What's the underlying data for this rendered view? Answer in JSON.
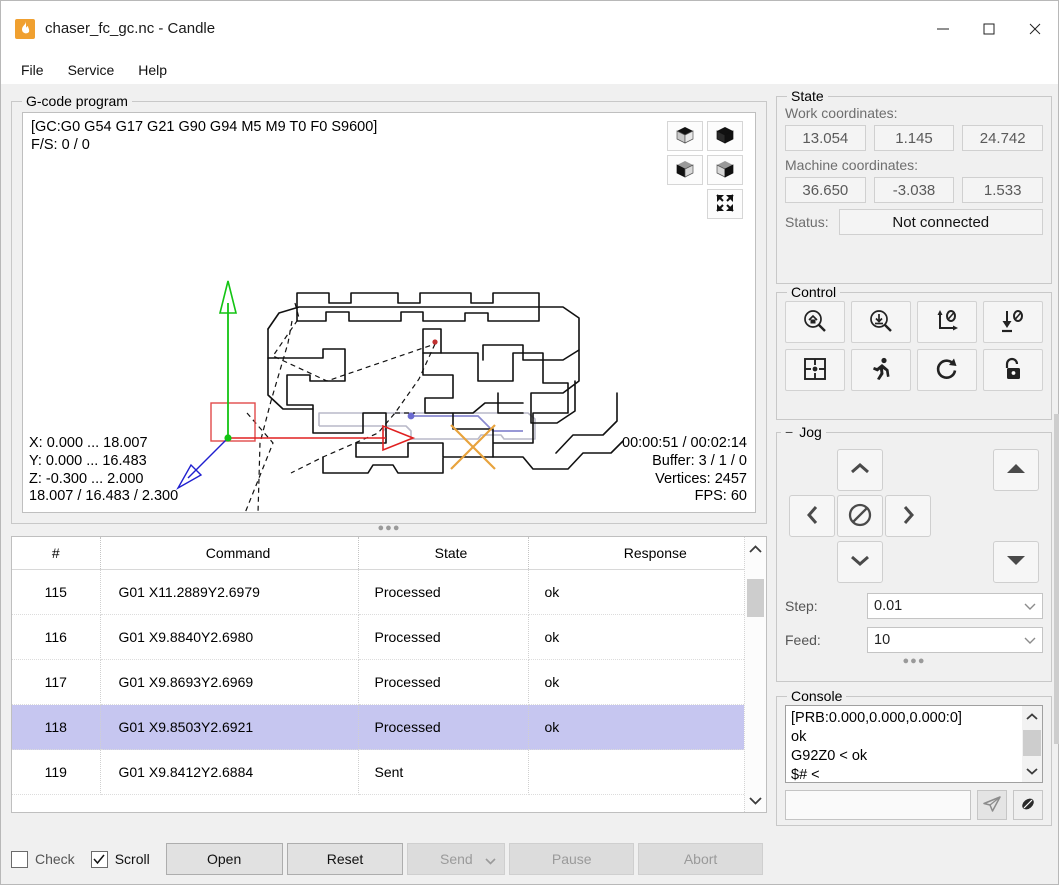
{
  "window": {
    "title": "chaser_fc_gc.nc - Candle",
    "app_icon": "flame-icon",
    "minimize": "—",
    "maximize": "□",
    "close": "✕"
  },
  "menubar": {
    "items": [
      "File",
      "Service",
      "Help"
    ]
  },
  "gcode_program": {
    "title": "G-code program",
    "viewer": {
      "overlay_top": "[GC:G0 G54 G17 G21 G90 G94 M5 M9 T0 F0 S9600]\nF/S: 0 / 0",
      "overlay_bottom_left": "X: 0.000 ... 18.007\nY: 0.000 ... 16.483\nZ: -0.300 ... 2.000\n18.007 / 16.483 / 2.300",
      "overlay_bottom_right": "00:00:51 / 00:02:14\nBuffer: 3 / 1 / 0\nVertices: 2457\nFPS: 60",
      "time_elapsed": "00:00:51",
      "time_total": "00:02:14",
      "buffer": "3 / 1 / 0",
      "vertices": "2457",
      "fps": "60",
      "toolbar_buttons": [
        {
          "name": "isometric-view-icon",
          "label": "Isometric view"
        },
        {
          "name": "top-view-icon",
          "label": "Top view"
        },
        {
          "name": "front-view-icon",
          "label": "Front view"
        },
        {
          "name": "left-view-icon",
          "label": "Left view"
        },
        {
          "name": "fit-to-screen-icon",
          "label": "Fit"
        }
      ],
      "colors": {
        "x_axis": "#e02020",
        "y_axis": "#13c413",
        "z_axis": "#2020d0",
        "toolpath": "#1a1a1a",
        "rapid": "#1a1a1a",
        "done": "#b9b9c8",
        "tool": "#e8a33d",
        "bounds": "#e24a4a"
      }
    }
  },
  "table": {
    "columns": [
      "#",
      "Command",
      "State",
      "Response"
    ],
    "rows": [
      {
        "num": "115",
        "command": "G01 X11.2889Y2.6979",
        "state": "Processed",
        "response": "ok",
        "selected": false
      },
      {
        "num": "116",
        "command": "G01 X9.8840Y2.6980",
        "state": "Processed",
        "response": "ok",
        "selected": false
      },
      {
        "num": "117",
        "command": "G01 X9.8693Y2.6969",
        "state": "Processed",
        "response": "ok",
        "selected": false
      },
      {
        "num": "118",
        "command": "G01 X9.8503Y2.6921",
        "state": "Processed",
        "response": "ok",
        "selected": true
      },
      {
        "num": "119",
        "command": "G01 X9.8412Y2.6884",
        "state": "Sent",
        "response": "",
        "selected": false
      }
    ],
    "selected_row_color": "#c6c6f0"
  },
  "bottom_toolbar": {
    "check": {
      "label": "Check",
      "checked": false
    },
    "scroll": {
      "label": "Scroll",
      "checked": true,
      "mark": "✓"
    },
    "open": "Open",
    "reset": "Reset",
    "send": "Send",
    "pause": "Pause",
    "abort": "Abort",
    "disabled": [
      "Send",
      "Pause",
      "Abort"
    ]
  },
  "state": {
    "title": "State",
    "work_label": "Work coordinates:",
    "work": [
      "13.054",
      "1.145",
      "24.742"
    ],
    "machine_label": "Machine coordinates:",
    "machine": [
      "36.650",
      "-3.038",
      "1.533"
    ],
    "status_label": "Status:",
    "status_value": "Not connected"
  },
  "control": {
    "title": "Control",
    "buttons": [
      {
        "name": "home-icon",
        "label": "Home"
      },
      {
        "name": "probe-icon",
        "label": "Z-probe"
      },
      {
        "name": "zero-xy-icon",
        "label": "Zero XY"
      },
      {
        "name": "zero-z-icon",
        "label": "Zero Z"
      },
      {
        "name": "safe-position-icon",
        "label": "Safe position"
      },
      {
        "name": "run-icon",
        "label": "Restore origin"
      },
      {
        "name": "reset-icon",
        "label": "Reset"
      },
      {
        "name": "unlock-icon",
        "label": "Unlock"
      }
    ]
  },
  "jog": {
    "title": "Jog",
    "collapse_glyph": "−",
    "buttons": [
      {
        "name": "jog-y-plus-icon",
        "label": "Y+"
      },
      {
        "name": "jog-x-minus-icon",
        "label": "X-"
      },
      {
        "name": "jog-stop-icon",
        "label": "Stop"
      },
      {
        "name": "jog-x-plus-icon",
        "label": "X+"
      },
      {
        "name": "jog-y-minus-icon",
        "label": "Y-"
      },
      {
        "name": "jog-z-plus-icon",
        "label": "Z+"
      },
      {
        "name": "jog-z-minus-icon",
        "label": "Z-"
      }
    ],
    "step_label": "Step:",
    "step_value": "0.01",
    "feed_label": "Feed:",
    "feed_value": "10"
  },
  "console": {
    "title": "Console",
    "lines": [
      "[PRB:0.000,0.000,0.000:0]",
      "ok",
      "G92Z0 < ok",
      "$# <"
    ],
    "input_value": "",
    "send_icon": "send-paper-plane-icon",
    "clear_icon": "eraser-icon"
  }
}
